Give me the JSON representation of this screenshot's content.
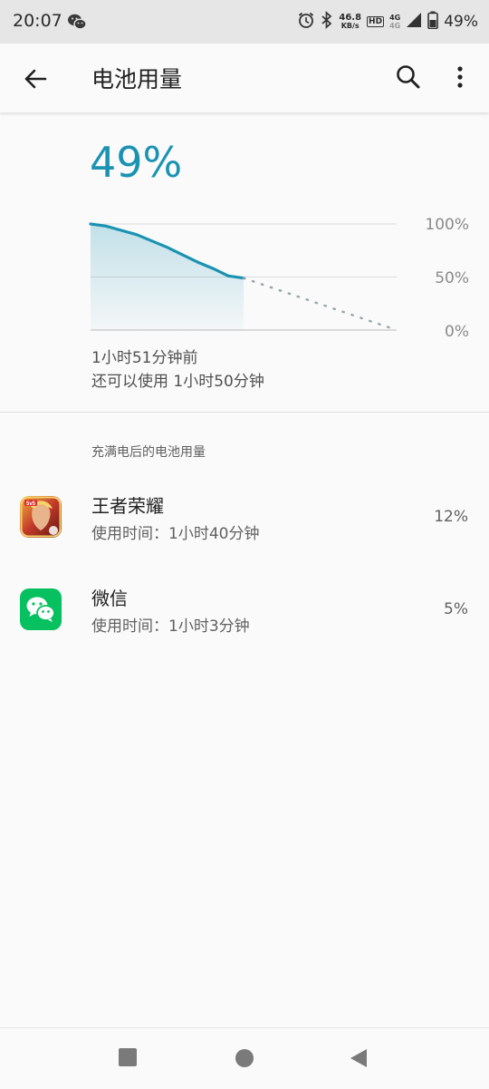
{
  "status_bar": {
    "time": "20:07",
    "net_speed_value": "46.8",
    "net_speed_unit": "KB/s",
    "hd_label": "HD",
    "lte_top": "4G",
    "lte_bottom": "4G",
    "battery_text": "49%"
  },
  "app_bar": {
    "title": "电池用量"
  },
  "battery": {
    "percent_text": "49%",
    "since_text": "1小时51分钟前",
    "remaining_text": "还可以使用 1小时50分钟",
    "accent_color": "#1a93b3"
  },
  "chart_data": {
    "type": "line",
    "y_ticks": [
      "100%",
      "50%",
      "0%"
    ],
    "ylim": [
      0,
      100
    ],
    "series": [
      {
        "style": "solid",
        "values": [
          100,
          98,
          94,
          90,
          84,
          78,
          71,
          64,
          58,
          51,
          49
        ]
      },
      {
        "style": "dotted-projection",
        "values": [
          49,
          0
        ]
      }
    ]
  },
  "section_title": "充满电后的电池用量",
  "apps": [
    {
      "name": "王者荣耀",
      "usage": "使用时间：1小时40分钟",
      "percent": "12%",
      "icon": "game-icon"
    },
    {
      "name": "微信",
      "usage": "使用时间：1小时3分钟",
      "percent": "5%",
      "icon": "wechat-icon"
    }
  ]
}
